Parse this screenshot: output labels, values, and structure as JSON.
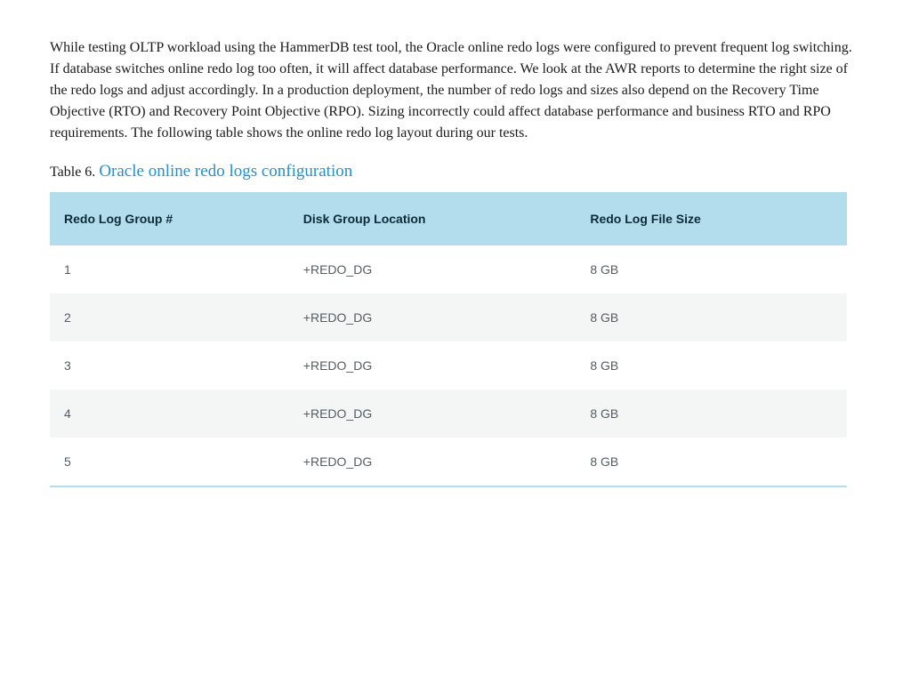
{
  "paragraph": "While testing OLTP workload using the HammerDB test tool, the Oracle online redo logs were configured to prevent frequent log switching. If database switches online redo log too often, it will affect database performance. We look at the AWR reports to determine the right size of the redo logs and adjust accordingly. In a production deployment, the number of redo logs and sizes also depend on the Recovery Time Objective (RTO) and Recovery Point Objective (RPO). Sizing incorrectly could affect database performance and business RTO and RPO requirements. The following table shows the online redo log layout during our tests.",
  "table": {
    "caption_prefix": "Table 6. ",
    "caption_title": "Oracle online redo logs configuration",
    "headers": {
      "col0": "Redo Log Group #",
      "col1": "Disk Group Location",
      "col2": "Redo Log File Size"
    },
    "rows": [
      {
        "group": "1",
        "location": "+REDO_DG",
        "size": "8 GB"
      },
      {
        "group": "2",
        "location": "+REDO_DG",
        "size": "8 GB"
      },
      {
        "group": "3",
        "location": "+REDO_DG",
        "size": "8 GB"
      },
      {
        "group": "4",
        "location": "+REDO_DG",
        "size": "8 GB"
      },
      {
        "group": "5",
        "location": "+REDO_DG",
        "size": "8 GB"
      }
    ]
  }
}
